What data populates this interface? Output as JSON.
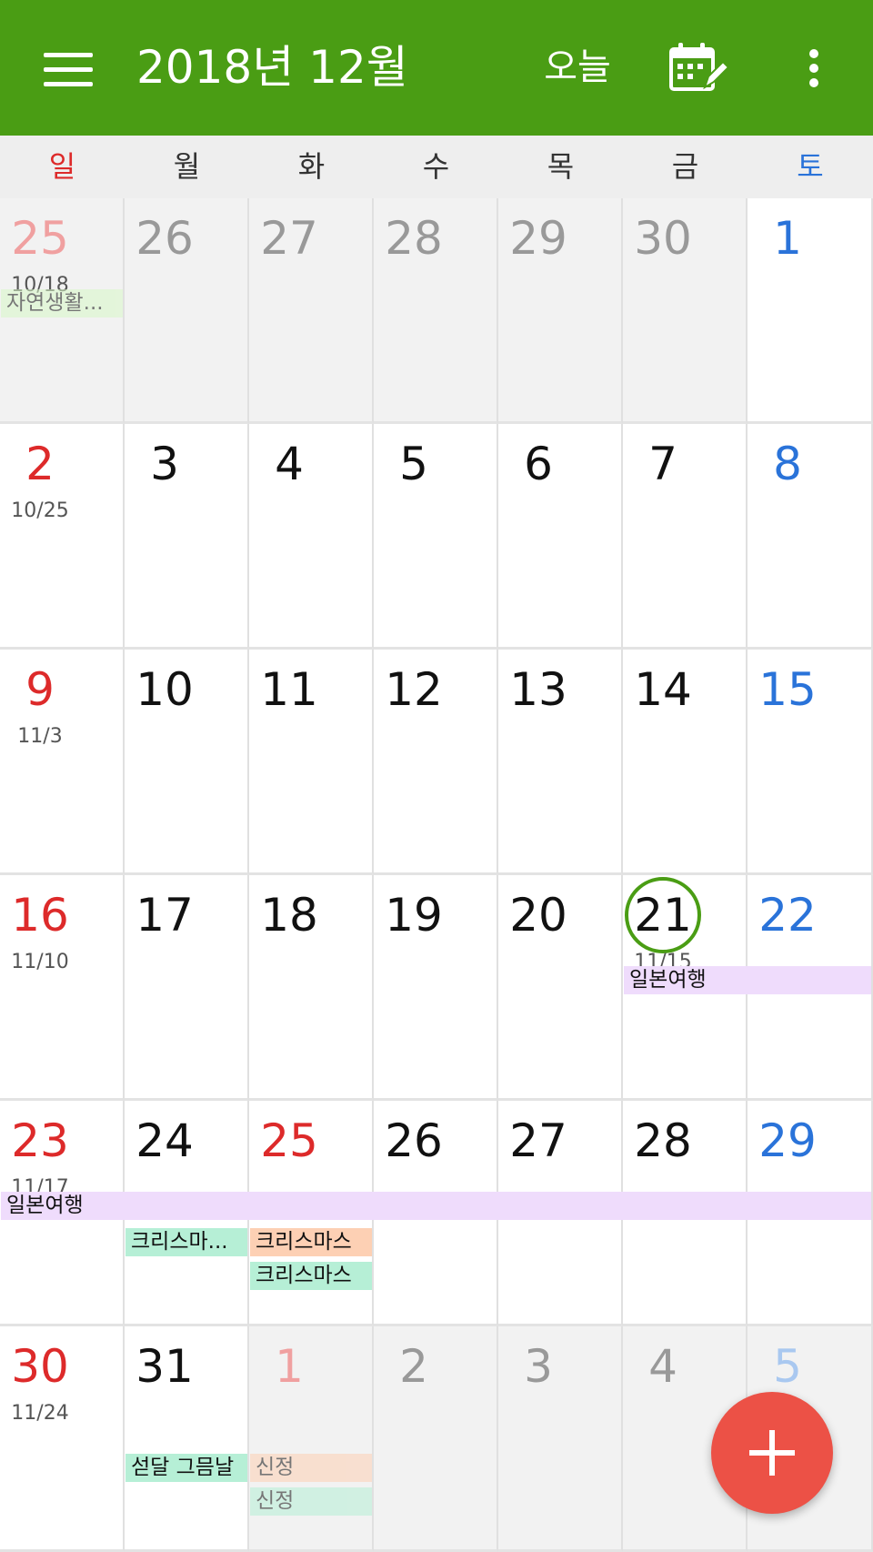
{
  "header": {
    "title": "2018년 12월",
    "today_label": "오늘",
    "icons": {
      "menu": "hamburger-menu-icon",
      "calendar_edit": "calendar-edit-icon",
      "more": "more-vertical-icon"
    }
  },
  "weekdays": [
    "일",
    "월",
    "화",
    "수",
    "목",
    "금",
    "토"
  ],
  "colors": {
    "primary": "#4a9d14",
    "sunday": "#dd2a2a",
    "saturday": "#2a73d9",
    "fab": "#ec5146",
    "event_lavender": "#efdcfc",
    "event_mint": "#b6efd6",
    "event_peach": "#fdd0b4",
    "event_light_green": "#d8f8c8"
  },
  "weeks": [
    {
      "days": [
        {
          "day": "25",
          "lunar": "10/18",
          "muted": true
        },
        {
          "day": "26",
          "muted": true
        },
        {
          "day": "27",
          "muted": true
        },
        {
          "day": "28",
          "muted": true
        },
        {
          "day": "29",
          "muted": true
        },
        {
          "day": "30",
          "muted": true
        },
        {
          "day": "1"
        }
      ]
    },
    {
      "days": [
        {
          "day": "2",
          "lunar": "10/25"
        },
        {
          "day": "3"
        },
        {
          "day": "4"
        },
        {
          "day": "5"
        },
        {
          "day": "6"
        },
        {
          "day": "7"
        },
        {
          "day": "8"
        }
      ]
    },
    {
      "days": [
        {
          "day": "9",
          "lunar": "11/3"
        },
        {
          "day": "10"
        },
        {
          "day": "11"
        },
        {
          "day": "12"
        },
        {
          "day": "13"
        },
        {
          "day": "14"
        },
        {
          "day": "15"
        }
      ]
    },
    {
      "days": [
        {
          "day": "16",
          "lunar": "11/10"
        },
        {
          "day": "17"
        },
        {
          "day": "18"
        },
        {
          "day": "19"
        },
        {
          "day": "20"
        },
        {
          "day": "21",
          "lunar": "11/15",
          "today": true
        },
        {
          "day": "22"
        }
      ]
    },
    {
      "days": [
        {
          "day": "23",
          "lunar": "11/17"
        },
        {
          "day": "24"
        },
        {
          "day": "25",
          "holiday": true
        },
        {
          "day": "26"
        },
        {
          "day": "27"
        },
        {
          "day": "28"
        },
        {
          "day": "29"
        }
      ]
    },
    {
      "days": [
        {
          "day": "30",
          "lunar": "11/24"
        },
        {
          "day": "31"
        },
        {
          "day": "1",
          "muted": true,
          "holiday": true
        },
        {
          "day": "2",
          "muted": true
        },
        {
          "day": "3",
          "muted": true
        },
        {
          "day": "4",
          "muted": true
        },
        {
          "day": "5",
          "muted": true
        }
      ]
    }
  ],
  "events": [
    {
      "title": "자연생활...",
      "week": 0,
      "start": 0,
      "span": 1,
      "row": 0,
      "color": "#d8f8c8",
      "muted": true
    },
    {
      "title": "일본여행",
      "week": 3,
      "start": 5,
      "span": 2,
      "row": 0,
      "color": "#efdcfc"
    },
    {
      "title": "일본여행",
      "week": 4,
      "start": 0,
      "span": 7,
      "row": 0,
      "color": "#efdcfc"
    },
    {
      "title": "크리스마...",
      "week": 4,
      "start": 1,
      "span": 1,
      "row": 1,
      "color": "#b6efd6"
    },
    {
      "title": "크리스마스",
      "week": 4,
      "start": 2,
      "span": 1,
      "row": 1,
      "color": "#fdd0b4"
    },
    {
      "title": "크리스마스",
      "week": 4,
      "start": 2,
      "span": 1,
      "row": 2,
      "color": "#b6efd6"
    },
    {
      "title": "섣달 그믐날",
      "week": 5,
      "start": 1,
      "span": 1,
      "row": 1,
      "color": "#b6efd6"
    },
    {
      "title": "신정",
      "week": 5,
      "start": 2,
      "span": 1,
      "row": 1,
      "color": "#fdd0b4",
      "muted": true
    },
    {
      "title": "신정",
      "week": 5,
      "start": 2,
      "span": 1,
      "row": 2,
      "color": "#b6efd6",
      "muted": true
    }
  ],
  "fab_icon": "plus-icon"
}
